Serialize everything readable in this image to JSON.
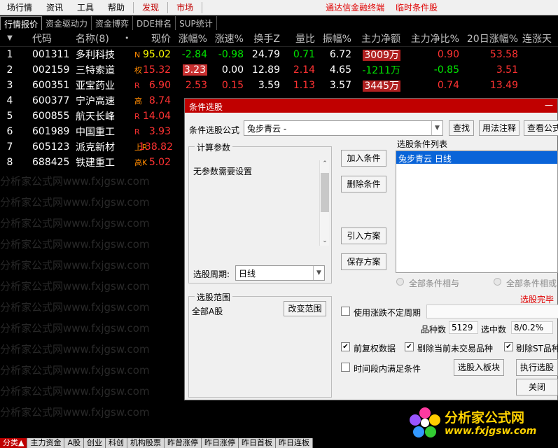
{
  "menu": {
    "items": [
      "场行情",
      "资讯",
      "工具",
      "帮助"
    ],
    "discover": "发现",
    "market": "市场",
    "promo1": "通达信金融终端",
    "promo2": "临时条件股"
  },
  "tabs": [
    "行情报价",
    "资金驱动力",
    "资金博弈",
    "DDE排名",
    "SUP统计"
  ],
  "table": {
    "headers": {
      "code": "代码",
      "name": "名称(8)",
      "dot": "•",
      "price": "现价",
      "chg": "涨幅%",
      "speed": "涨速%",
      "turnover": "换手Z",
      "vol_ratio": "量比",
      "amp": "振幅%",
      "net": "主力净额",
      "netp": "主力净比%",
      "d20": "20日涨幅%",
      "up_days": "连涨天"
    },
    "rows": [
      {
        "idx": "1",
        "code": "001311",
        "name": "多利科技",
        "flag": "N",
        "price": "95.02",
        "chg": "-2.84",
        "speed": "-0.98",
        "turnover": "24.79",
        "vol_ratio": "0.71",
        "amp": "6.72",
        "net": "3009万",
        "netp": "0.90",
        "d20": "53.58",
        "up_days": ""
      },
      {
        "idx": "2",
        "code": "002159",
        "name": "三特索道",
        "flag": "权",
        "price": "15.32",
        "chg": "3.23",
        "speed": "0.00",
        "turnover": "12.89",
        "vol_ratio": "2.14",
        "amp": "4.65",
        "net": "-1211万",
        "netp": "-0.85",
        "d20": "3.51",
        "up_days": ""
      },
      {
        "idx": "3",
        "code": "600351",
        "name": "亚宝药业",
        "flag": "R",
        "price": "6.90",
        "chg": "2.53",
        "speed": "0.15",
        "turnover": "3.59",
        "vol_ratio": "1.13",
        "amp": "3.57",
        "net": "3445万",
        "netp": "0.74",
        "d20": "13.49",
        "up_days": ""
      },
      {
        "idx": "4",
        "code": "600377",
        "name": "宁沪高速",
        "flag": "高",
        "price": "8.74",
        "chg": "",
        "speed": "",
        "turnover": "",
        "vol_ratio": "",
        "amp": "",
        "net": "",
        "netp": "",
        "d20": "",
        "up_days": ""
      },
      {
        "idx": "5",
        "code": "600855",
        "name": "航天长峰",
        "flag": "R",
        "price": "14.04",
        "chg": "",
        "speed": "",
        "turnover": "",
        "vol_ratio": "",
        "amp": "",
        "net": "",
        "netp": "",
        "d20": "",
        "up_days": ""
      },
      {
        "idx": "6",
        "code": "601989",
        "name": "中国重工",
        "flag": "R",
        "price": "3.93",
        "chg": "",
        "speed": "",
        "turnover": "",
        "vol_ratio": "",
        "amp": "",
        "net": "",
        "netp": "",
        "d20": "",
        "up_days": ""
      },
      {
        "idx": "7",
        "code": "605123",
        "name": "派克新材",
        "flag": "上R",
        "price": "138.82",
        "chg": "",
        "speed": "",
        "turnover": "",
        "vol_ratio": "",
        "amp": "",
        "net": "",
        "netp": "",
        "d20": "",
        "up_days": ""
      },
      {
        "idx": "8",
        "code": "688425",
        "name": "铁建重工",
        "flag": "高K",
        "price": "5.02",
        "chg": "",
        "speed": "",
        "turnover": "",
        "vol_ratio": "",
        "amp": "",
        "net": "",
        "netp": "",
        "d20": "",
        "up_days": ""
      }
    ]
  },
  "watermark": "分析家公式网www.fxjgsw.com",
  "dialog": {
    "title": "条件选股",
    "formula_label": "条件选股公式",
    "formula_value": "兔步青云 -",
    "btn_search": "查找",
    "btn_usage": "用法注释",
    "btn_view": "查看公式",
    "params_title": "计算参数",
    "params_text": "无参数需要设置",
    "period_label": "选股周期:",
    "period_value": "日线",
    "btn_add": "加入条件",
    "btn_delete": "删除条件",
    "btn_import": "引入方案",
    "btn_save": "保存方案",
    "list_title": "选股条件列表",
    "list_item": "兔步青云 日线",
    "radio_and": "全部条件相与",
    "radio_or": "全部条件相或",
    "done_text": "选股完毕",
    "range_title": "选股范围",
    "range_value": "全部A股",
    "btn_range": "改变范围",
    "chk_unfixed": "使用涨跌不定周期",
    "count_label": "品种数",
    "count_value": "5129",
    "selected_label": "选中数",
    "selected_value": "8/0.2%",
    "chk_adjust": "前复权数据",
    "chk_remove_untraded": "剔除当前未交易品种",
    "chk_remove_st": "剔除ST品种",
    "chk_interval": "时间段内满足条件",
    "btn_to_block": "选股入板块",
    "btn_exec": "执行选股",
    "btn_close": "关闭"
  },
  "status": [
    "分类▲",
    "主力资金",
    "A股",
    "创业",
    "科创",
    "机构股票",
    "昨曾涨停",
    "昨日涨停",
    "昨日首板",
    "昨日连板"
  ],
  "logo": {
    "title": "分析家公式网",
    "url": "www.fxjgsw.com"
  }
}
